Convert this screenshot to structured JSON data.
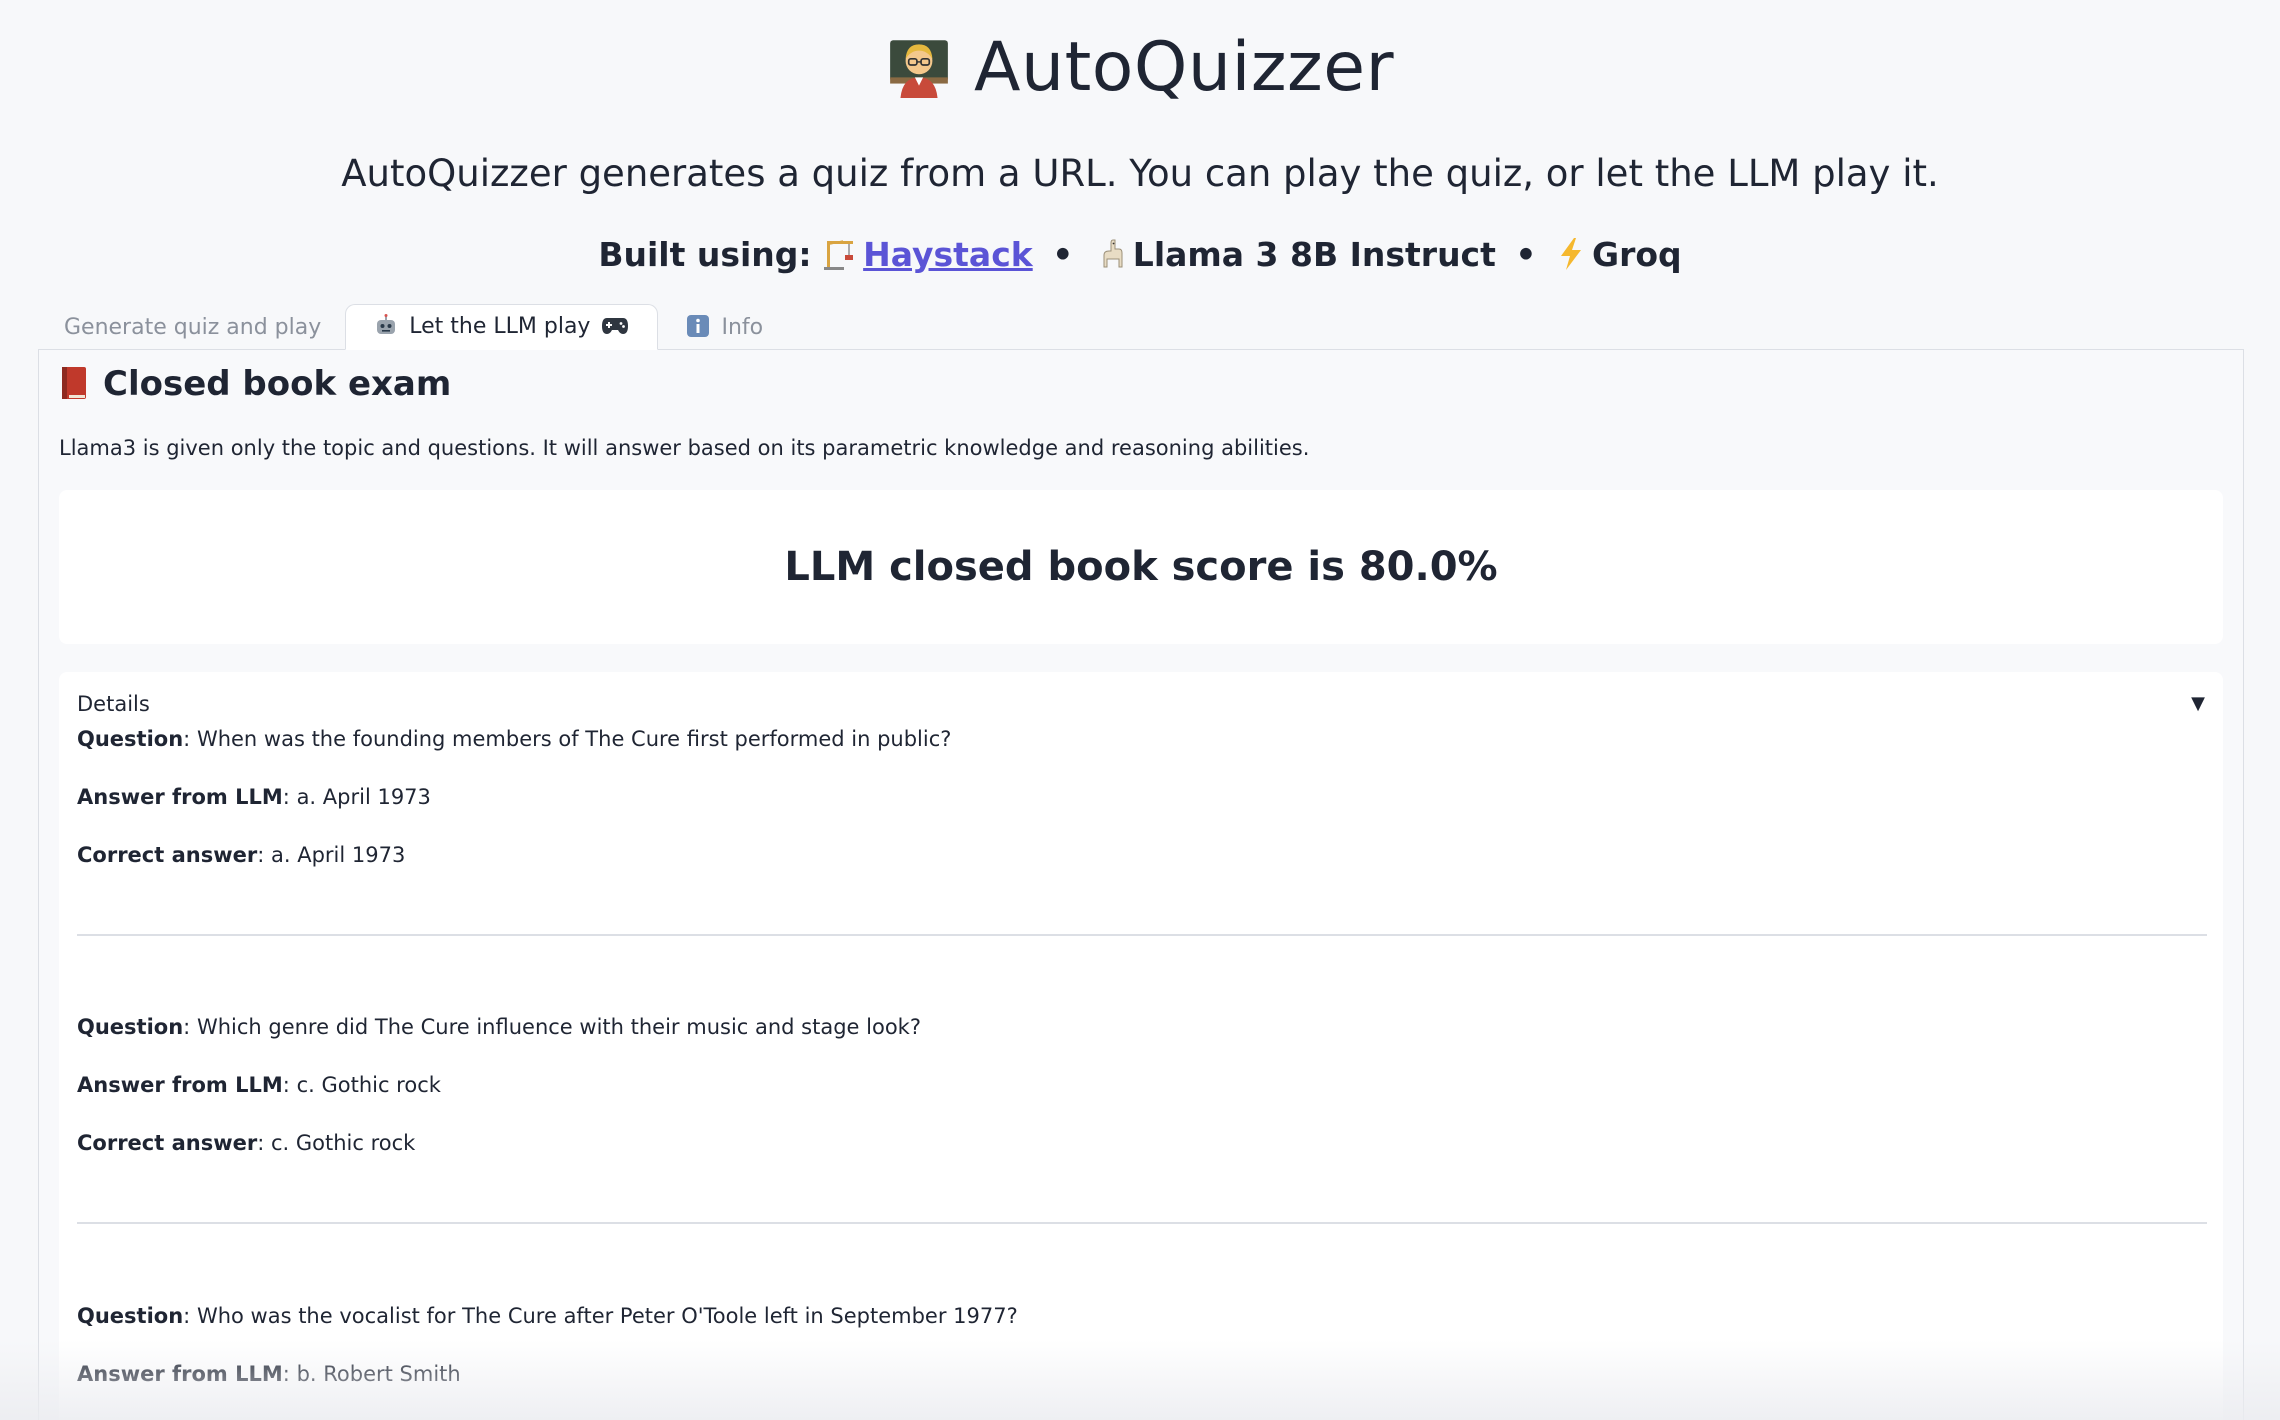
{
  "header": {
    "title_icon": "teacher-emoji-icon",
    "title": "AutoQuizzer",
    "subtitle": "AutoQuizzer generates a quiz from a URL. You can play the quiz, or let the LLM play it.",
    "built_using_label": "Built using:",
    "haystack_icon": "crane-icon",
    "haystack_link": "Haystack",
    "llama_icon": "llama-icon",
    "llama_text": "Llama 3 8B Instruct",
    "groq_icon": "lightning-icon",
    "groq_text": "Groq",
    "separator": "•"
  },
  "tabs": [
    {
      "label": "Generate quiz and play",
      "active": false
    },
    {
      "label": "Let the LLM play",
      "icon_left": "robot-icon",
      "icon_right": "gamepad-icon",
      "active": true
    },
    {
      "label": "Info",
      "icon_left": "info-icon",
      "active": false
    }
  ],
  "section": {
    "icon": "closed-book-icon",
    "title": "Closed book exam",
    "description": "Llama3 is given only the topic and questions. It will answer based on its parametric knowledge and reasoning abilities."
  },
  "score": {
    "text": "LLM closed book score is 80.0%"
  },
  "details": {
    "summary": "Details",
    "question_label": "Question",
    "answer_label": "Answer from LLM",
    "correct_label": "Correct answer",
    "items": [
      {
        "question": "When was the founding members of The Cure first performed in public?",
        "answer": "a. April 1973",
        "correct": "a. April 1973"
      },
      {
        "question": "Which genre did The Cure influence with their music and stage look?",
        "answer": "c. Gothic rock",
        "correct": "c. Gothic rock"
      },
      {
        "question": "Who was the vocalist for The Cure after Peter O'Toole left in September 1977?",
        "answer": "b. Robert Smith",
        "correct": ""
      }
    ]
  }
}
